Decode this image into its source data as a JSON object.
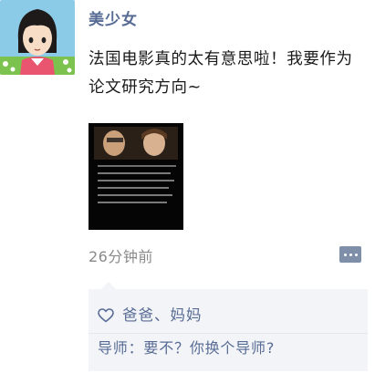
{
  "post": {
    "username": "美少女",
    "text": "法国电影真的太有意思啦！我要作为论文研究方向~",
    "timestamp": "26分钟前"
  },
  "interactions": {
    "likes": "爸爸、妈妈",
    "comments": [
      {
        "author": "导师",
        "separator": "：",
        "text": "要不？你换个导师?"
      }
    ]
  },
  "icons": {
    "avatar": "cartoon-girl-avatar",
    "thumbnail": "movie-still-image",
    "more": "more-options-icon",
    "like": "heart-icon"
  },
  "colors": {
    "link": "#576b95",
    "text": "#1a1a1a",
    "meta": "#8a8a8a",
    "panel": "#f3f4f7"
  }
}
